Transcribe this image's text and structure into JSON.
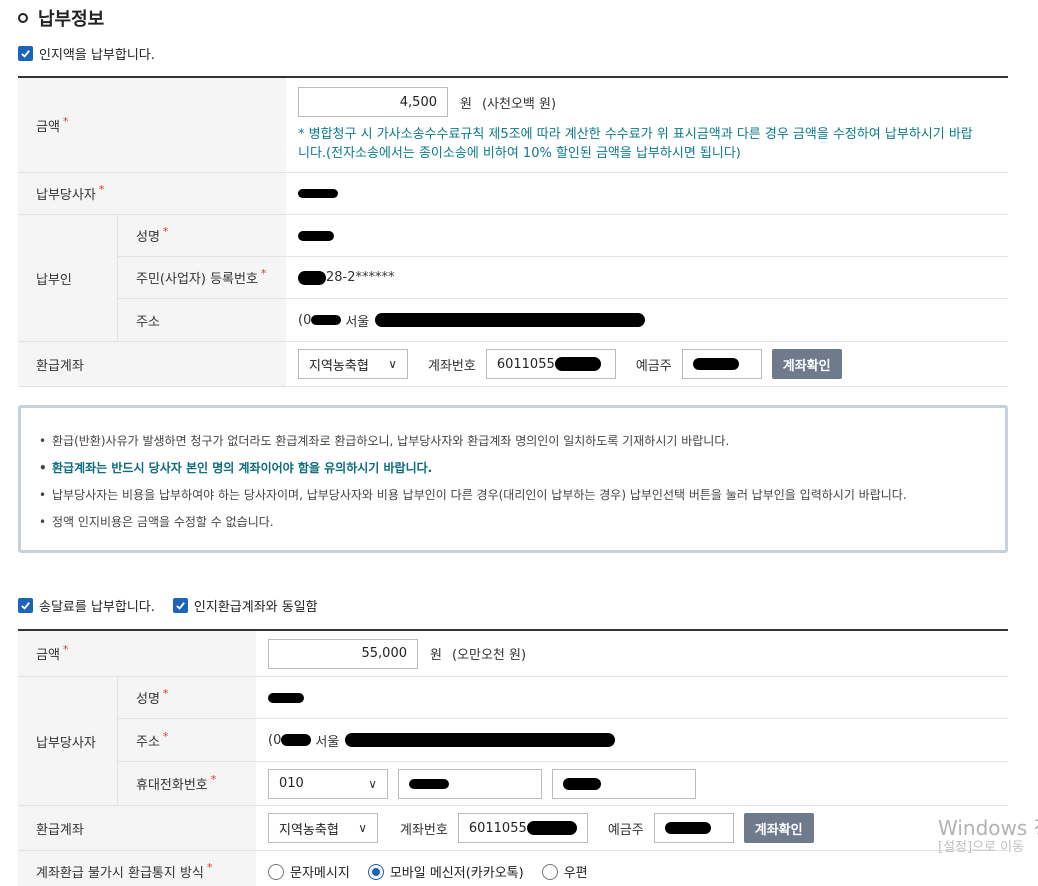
{
  "section_title": "납부정보",
  "stamp_fee": {
    "checkbox_label": "인지액을 납부합니다.",
    "amount_label": "금액",
    "amount_value": "4,500",
    "amount_unit": "원",
    "amount_korean": "(사천오백 원)",
    "amount_note": "* 병합청구 시 가사소송수수료규칙 제5조에 따라 계산한 수수료가 위 표시금액과 다른 경우 금액을 수정하여 납부하시기 바랍니다.(전자소송에서는 종이소송에 비하여 10% 할인된 금액을 납부하시면 됩니다)",
    "party_label": "납부당사자",
    "payer_label": "납부인",
    "name_label": "성명",
    "id_label": "주민(사업자) 등록번호",
    "id_value_suffix": "28-2******",
    "address_label": "주소",
    "address_prefix": "(0",
    "address_city": "서울",
    "refund_label": "환급계좌",
    "bank_value": "지역농축협",
    "account_label": "계좌번호",
    "account_value": "6011055",
    "holder_label": "예금주",
    "verify_button": "계좌확인"
  },
  "notice": [
    "환급(반환)사유가 발생하면 청구가 없더라도 환급계좌로 환급하오니, 납부당사자와 환급계좌 명의인이 일치하도록 기재하시기 바랍니다.",
    "환급계좌는 반드시 당사자 본인 명의 계좌이어야 함을 유의하시기 바랍니다.",
    "납부당사자는 비용을 납부하여야 하는 당사자이며, 납부당사자와 비용 납부인이 다른 경우(대리인이 납부하는 경우) 납부인선택 버튼을 눌러 납부인을 입력하시기 바랍니다.",
    "정액 인지비용은 금액을 수정할 수 없습니다."
  ],
  "postage": {
    "checkbox_label": "송달료를 납부합니다.",
    "same_account_label": "인지환급계좌와 동일함",
    "amount_label": "금액",
    "amount_value": "55,000",
    "amount_unit": "원",
    "amount_korean": "(오만오천 원)",
    "party_label": "납부당사자",
    "name_label": "성명",
    "address_label": "주소",
    "address_prefix": "(0",
    "address_city": "서울",
    "phone_label": "휴대전화번호",
    "phone_prefix": "010",
    "refund_label": "환급계좌",
    "bank_value": "지역농축협",
    "account_label": "계좌번호",
    "account_value": "6011055",
    "holder_label": "예금주",
    "verify_button": "계좌확인",
    "notify_label": "계좌환급 불가시 환급통지 방식",
    "notify_options": [
      "문자메시지",
      "모바일 메신저(카카오톡)",
      "우편"
    ],
    "notify_selected": "모바일 메신저(카카오톡)"
  },
  "watermark": {
    "line1": "Windows 정",
    "line2": "[설정]으로 이동"
  },
  "colors": {
    "checkbox": "#1b64b8",
    "note_text": "#0c7a8c",
    "button": "#6f7b8c",
    "required": "#dd3333"
  }
}
